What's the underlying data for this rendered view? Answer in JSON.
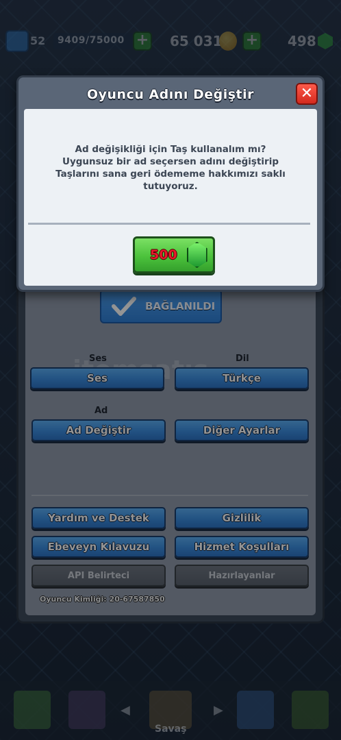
{
  "topbar": {
    "level": "52",
    "xp": "9409/75000",
    "gold": "65 031",
    "gems": "498"
  },
  "settings": {
    "linked_label": "BAĞLANILDI",
    "sound_label": "Ses",
    "sound_button": "Ses",
    "language_label": "Dil",
    "language_button": "Türkçe",
    "name_label": "Ad",
    "change_name_button": "Ad Değiştir",
    "other_settings_button": "Diğer Ayarlar",
    "help_button": "Yardım ve Destek",
    "privacy_button": "Gizlilik",
    "parent_guide_button": "Ebeveyn Kılavuzu",
    "terms_button": "Hizmet Koşulları",
    "api_button": "API Belirteci",
    "credits_button": "Hazırlayanlar",
    "player_id": "Oyuncu Kimliği: 20-67587850",
    "watermark": "itemsatış"
  },
  "nav": {
    "battle_label": "Savaş"
  },
  "dialog": {
    "title": "Oyuncu Adını Değiştir",
    "message_line1": "Ad değişikliği için Taş kullanalım mı?",
    "message_line2": "Uygunsuz bir ad seçersen adını değiştirip",
    "message_line3": "Taşlarını sana geri ödememe hakkımızı saklı",
    "message_line4": "tutuyoruz.",
    "cost": "500",
    "cost_icon": "gem-icon"
  },
  "colors": {
    "close_red": "#d32a1e",
    "confirm_green": "#4cc23c",
    "cost_red": "#e8192c",
    "button_blue": "#3b8de0"
  }
}
